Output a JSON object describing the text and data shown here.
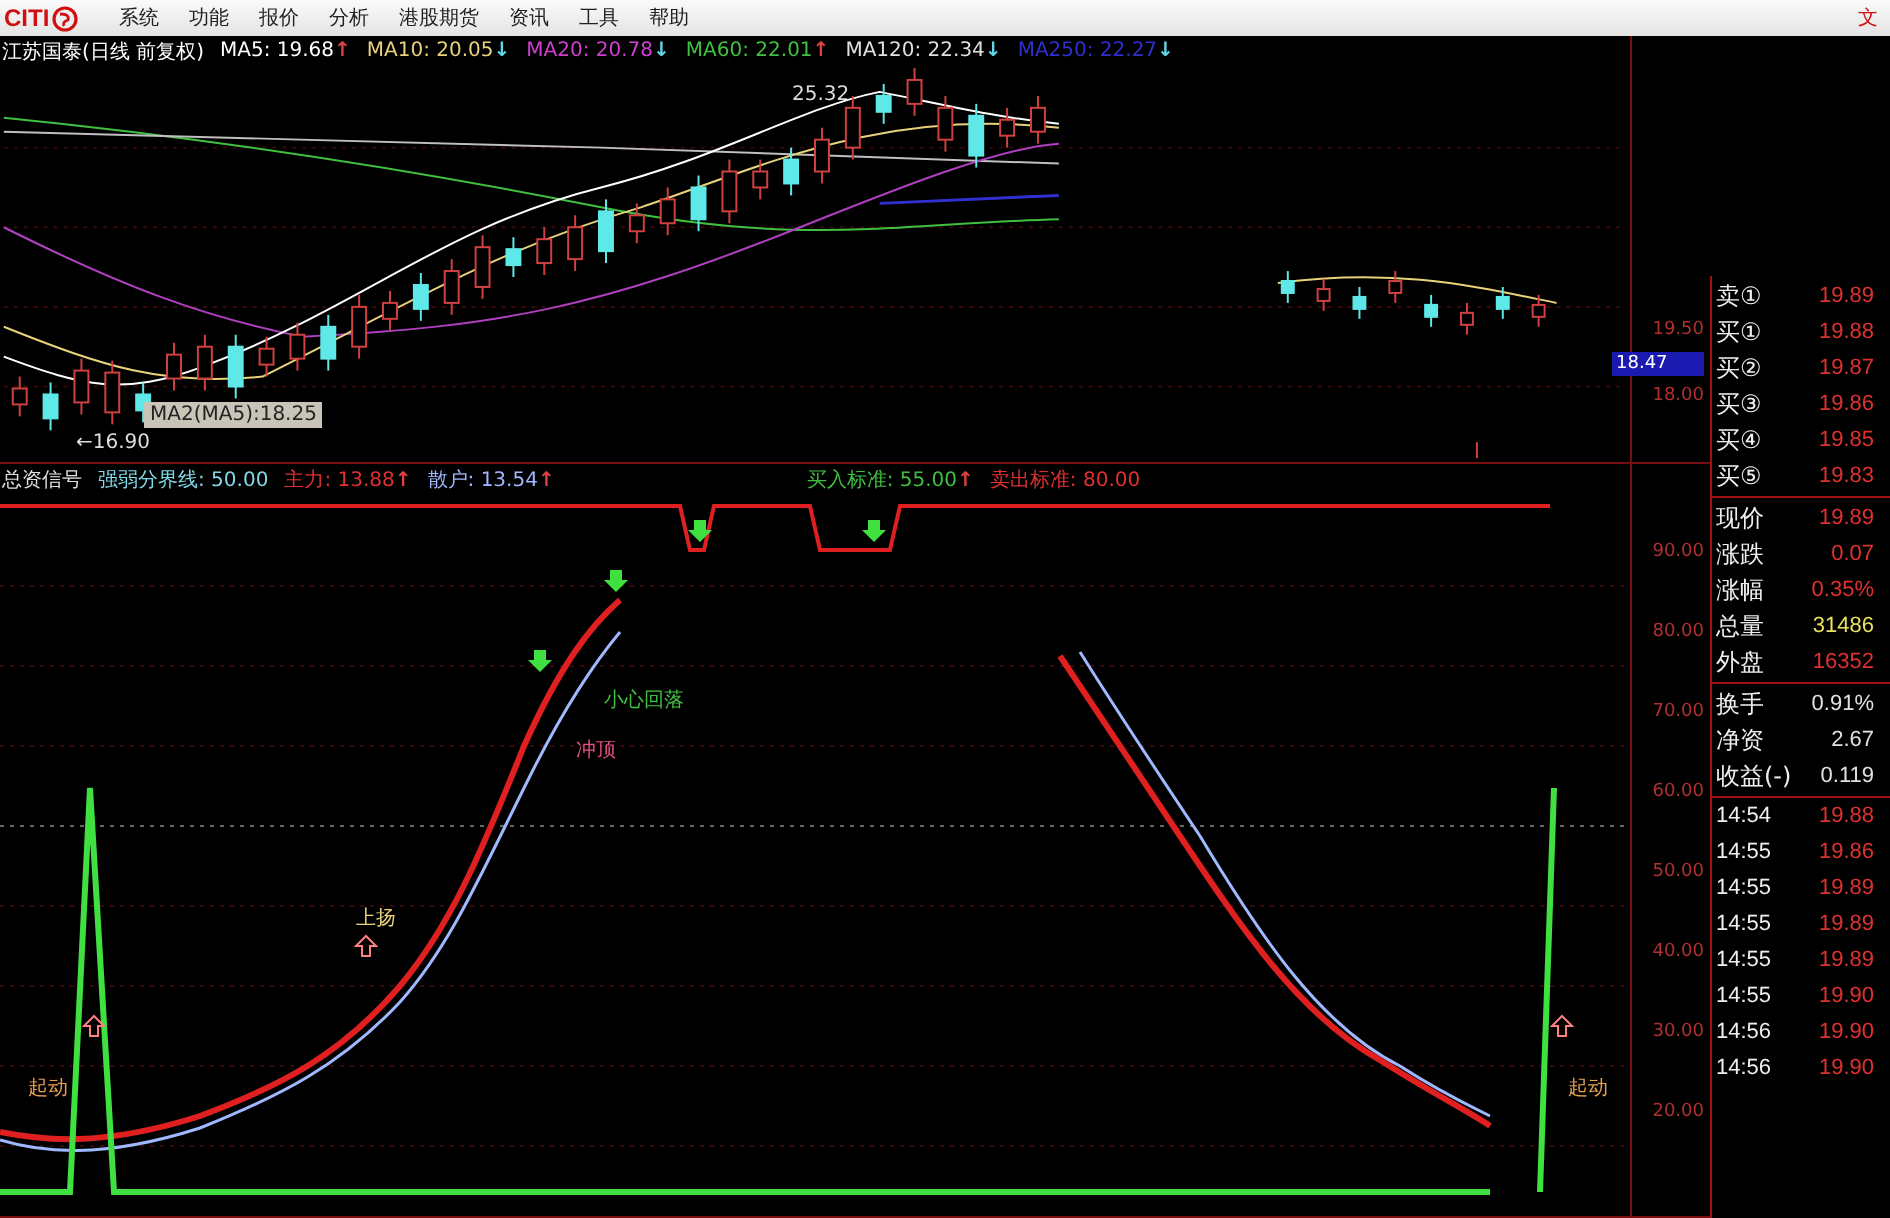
{
  "menu_bar": {
    "logo": "CITI",
    "items": [
      "系统",
      "功能",
      "报价",
      "分析",
      "港股期货",
      "资讯",
      "工具",
      "帮助"
    ],
    "corner": "文"
  },
  "price_chart": {
    "legend": [
      {
        "label": "江苏国泰(日线 前复权)",
        "color": "#ffffff"
      },
      {
        "label": "MA5: 19.68",
        "color": "#ffffff",
        "arrow": {
          "text": "↑",
          "color": "#e04040"
        }
      },
      {
        "label": "MA10: 20.05",
        "color": "#e8d27a",
        "arrow": {
          "text": "↓",
          "color": "#60d8e8"
        }
      },
      {
        "label": "MA20: 20.78",
        "color": "#d040d0",
        "arrow": {
          "text": "↓",
          "color": "#60d8e8"
        }
      },
      {
        "label": "MA60: 22.01",
        "color": "#40c040",
        "arrow": {
          "text": "↑",
          "color": "#e04040"
        }
      },
      {
        "label": "MA120: 22.34",
        "color": "#e0e0e0",
        "arrow": {
          "text": "↓",
          "color": "#60d8e8"
        }
      },
      {
        "label": "MA250: 22.27",
        "color": "#3030d0",
        "arrow": {
          "text": "↓",
          "color": "#60d8e8"
        }
      }
    ],
    "high_label": "25.32",
    "low_label": "←16.90",
    "tooltip": "MA2(MA5):18.25",
    "axis_labels": [
      "19.50",
      "18.00"
    ],
    "current_price": "18.47"
  },
  "indicator": {
    "legend": [
      {
        "label": "总资信号",
        "color": "#e0e0e0"
      },
      {
        "label": "强弱分界线: 50.00",
        "color": "#80d8e8"
      },
      {
        "label": "主力: 13.88",
        "color": "#e03030",
        "arrow": {
          "text": "↑",
          "color": "#e04040"
        }
      },
      {
        "label": "散户: 13.54",
        "color": "#a0b8ff",
        "arrow": {
          "text": "↑",
          "color": "#e04040"
        }
      }
    ],
    "thresholds": [
      {
        "label": "买入标准: 55.00",
        "color": "#40c040",
        "arrow": {
          "text": "↑",
          "color": "#e04040"
        }
      },
      {
        "label": "卖出标准: 80.00",
        "color": "#e03030"
      }
    ],
    "axis_labels": [
      "90.00",
      "80.00",
      "70.00",
      "60.00",
      "50.00",
      "40.00",
      "30.00",
      "20.00"
    ],
    "annotations": [
      {
        "text": "小心回落",
        "color": "#40c040"
      },
      {
        "text": "冲顶",
        "color": "#e05080"
      },
      {
        "text": "上扬",
        "color": "#e8d27a"
      },
      {
        "text": "起动",
        "color": "#e8a050"
      },
      {
        "text": "起动",
        "color": "#e8a050"
      }
    ]
  },
  "quote_panel": {
    "order_book": [
      {
        "label": "卖①",
        "value": "19.89",
        "color": "#e03030"
      },
      {
        "label": "买①",
        "value": "19.88",
        "color": "#e03030"
      },
      {
        "label": "买②",
        "value": "19.87",
        "color": "#e03030"
      },
      {
        "label": "买③",
        "value": "19.86",
        "color": "#e03030"
      },
      {
        "label": "买④",
        "value": "19.85",
        "color": "#e03030"
      },
      {
        "label": "买⑤",
        "value": "19.83",
        "color": "#e03030"
      }
    ],
    "stats": [
      {
        "label": "现价",
        "value": "19.89",
        "color": "#e03030"
      },
      {
        "label": "涨跌",
        "value": "0.07",
        "color": "#e03030"
      },
      {
        "label": "涨幅",
        "value": "0.35%",
        "color": "#e03030"
      },
      {
        "label": "总量",
        "value": "31486",
        "color": "#e8e060"
      },
      {
        "label": "外盘",
        "value": "16352",
        "color": "#e03030"
      }
    ],
    "more_stats": [
      {
        "label": "换手",
        "value": "0.91%",
        "color": "#e0e0e0"
      },
      {
        "label": "净资",
        "value": "2.67",
        "color": "#e0e0e0"
      },
      {
        "label": "收益(-)",
        "value": "0.119",
        "color": "#e0e0e0"
      }
    ],
    "ticks": [
      {
        "time": "14:54",
        "price": "19.88"
      },
      {
        "time": "14:55",
        "price": "19.86"
      },
      {
        "time": "14:55",
        "price": "19.89"
      },
      {
        "time": "14:55",
        "price": "19.89"
      },
      {
        "time": "14:55",
        "price": "19.89"
      },
      {
        "time": "14:55",
        "price": "19.90"
      },
      {
        "time": "14:56",
        "price": "19.90"
      },
      {
        "time": "14:56",
        "price": "19.90"
      }
    ]
  }
}
